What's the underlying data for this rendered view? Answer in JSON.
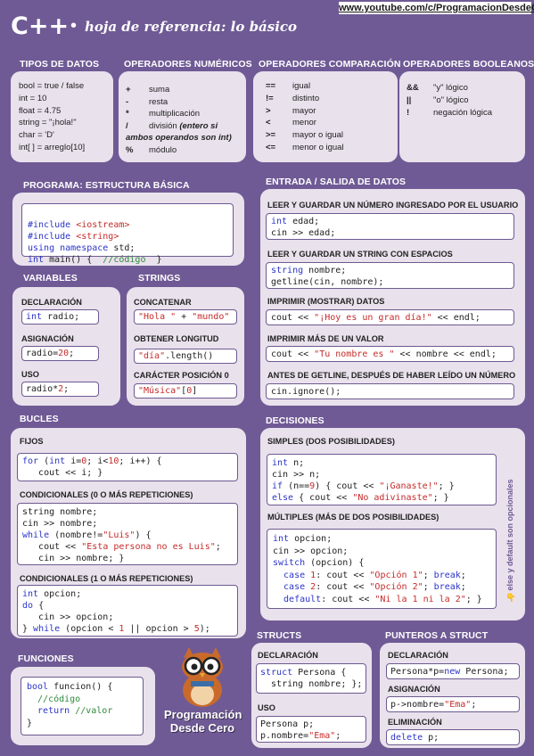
{
  "header": {
    "url": "www.youtube.com/c/ProgramacionDesdeCero",
    "brand": "C++",
    "dot": "•",
    "subtitle": "hoja de referencia: lo básico"
  },
  "tipos": {
    "title": "TIPOS DE DATOS",
    "lines": [
      "bool = true / false",
      "int = 10",
      "float = 4.75",
      "string = \"¡hola!\"",
      "char = 'D'",
      "int[ ] = arreglo[10]"
    ]
  },
  "numericos": {
    "title": "OPERADORES NUMÉRICOS",
    "items": [
      {
        "sym": "+",
        "desc": "suma"
      },
      {
        "sym": "-",
        "desc": "resta"
      },
      {
        "sym": "*",
        "desc": "multiplicación"
      },
      {
        "sym": "/",
        "desc": "división",
        "note": "(entero si",
        "note2": "ambos operandos son int)"
      },
      {
        "sym": "%",
        "desc": "módulo"
      }
    ]
  },
  "comparacion": {
    "title": "OPERADORES COMPARACIÓN",
    "items": [
      {
        "sym": "==",
        "desc": "igual"
      },
      {
        "sym": "!=",
        "desc": "distinto"
      },
      {
        "sym": ">",
        "desc": "mayor"
      },
      {
        "sym": "<",
        "desc": "menor"
      },
      {
        "sym": ">=",
        "desc": "mayor o igual"
      },
      {
        "sym": "<=",
        "desc": "menor o igual"
      }
    ]
  },
  "booleanos": {
    "title": "OPERADORES BOOLEANOS",
    "items": [
      {
        "sym": "&&",
        "desc": "\"y\" lógico"
      },
      {
        "sym": "||",
        "desc": "\"o\" lógico"
      },
      {
        "sym": "!",
        "desc": "negación lógica"
      }
    ]
  },
  "programa": {
    "title": "PROGRAMA: ESTRUCTURA BÁSICA",
    "l1a": "#include ",
    "l1b": "<iostream>",
    "l2a": "#include ",
    "l2b": "<string>",
    "l3a": "using namespace",
    "l3b": " std;",
    "l4a": "int",
    "l4b": " main() {  ",
    "l4c": "//código",
    "l4d": "  }"
  },
  "variables": {
    "title": "VARIABLES",
    "decl_label": "DECLARACIÓN",
    "decl_kw": "int",
    "decl_code": " radio;",
    "asig_label": "ASIGNACIÓN",
    "asig_code": "radio=",
    "asig_num": "20",
    "asig_end": ";",
    "uso_label": "USO",
    "uso_code": "radio*",
    "uso_num": "2",
    "uso_end": ";"
  },
  "strings": {
    "title": "STRINGS",
    "concat_label": "CONCATENAR",
    "concat_s1": "\"Hola \"",
    "concat_op": " + ",
    "concat_s2": "\"mundo\"",
    "len_label": "OBTENER LONGITUD",
    "len_s": "\"día\"",
    "len_code": ".length()",
    "char_label": "CARÁCTER POSICIÓN 0",
    "char_s": "\"Música\"",
    "char_code": "[",
    "char_num": "0",
    "char_end": "]"
  },
  "io": {
    "title": "ENTRADA / SALIDA DE DATOS",
    "l1": "LEER Y GUARDAR  UN NÚMERO INGRESADO POR EL USUARIO",
    "c1a": "int",
    "c1b": " edad;",
    "c1c": "cin >> edad;",
    "l2": "LEER Y GUARDAR UN STRING CON ESPACIOS",
    "c2a": "string",
    "c2b": " nombre;",
    "c2c": "getline(cin, nombre);",
    "l3": "IMPRIMIR (MOSTRAR) DATOS",
    "c3a": "cout << ",
    "c3b": "\"¡Hoy es un gran día!\"",
    "c3c": " << endl;",
    "l4": "IMPRIMIR MÁS DE UN VALOR",
    "c4a": "cout << ",
    "c4b": "\"Tu nombre es \"",
    "c4c": " << nombre << endl;",
    "l5": "ANTES DE GETLINE, DESPUÉS DE HABER LEÍDO UN NÚMERO",
    "c5": "cin.ignore();"
  },
  "bucles": {
    "title": "BUCLES",
    "fijos_label": "FIJOS",
    "f1a": "for",
    "f1b": " (",
    "f1c": "int",
    "f1d": " i=",
    "f1e": "0",
    "f1f": "; i<",
    "f1g": "10",
    "f1h": "; i++) {",
    "f2": "   cout << i; }",
    "w_label": "CONDICIONALES (0 O MÁS REPETICIONES)",
    "w1": "string nombre;",
    "w2": "cin >> nombre;",
    "w3a": "while",
    "w3b": " (nombre!=",
    "w3c": "\"Luis\"",
    "w3d": ") {",
    "w4a": "   cout << ",
    "w4b": "\"Esta persona no es Luis\"",
    "w4c": ";",
    "w5": "   cin >> nombre; }",
    "d_label": "CONDICIONALES (1 O MÁS REPETICIONES)",
    "d1a": "int",
    "d1b": " opcion;",
    "d2": "do",
    "d2b": " {",
    "d3": "   cin >> opcion;",
    "d4a": "} ",
    "d4b": "while",
    "d4c": " (opcion < ",
    "d4d": "1",
    "d4e": " || opcion > ",
    "d4f": "5",
    "d4g": ");"
  },
  "decisiones": {
    "title": "DECISIONES",
    "simple_label": "SIMPLES (DOS POSIBILIDADES)",
    "s1a": "int",
    "s1b": " n;",
    "s2": "cin >> n;",
    "s3a": "if",
    "s3b": " (n==",
    "s3c": "9",
    "s3d": ") { cout << ",
    "s3e": "\"¡Ganaste!\"",
    "s3f": "; }",
    "s4a": "else",
    "s4b": " { cout << ",
    "s4c": "\"No adivinaste\"",
    "s4d": "; }",
    "multi_label": "MÚLTIPLES (MÁS DE DOS POSIBILIDADES)",
    "m1a": "int",
    "m1b": " opcion;",
    "m2": "cin >> opcion;",
    "m3a": "switch",
    "m3b": " (opcion) {",
    "m4a": "  case ",
    "m4b": "1",
    "m4c": ": cout << ",
    "m4d": "\"Opción 1\"",
    "m4e": "; ",
    "m4f": "break",
    "m4g": ";",
    "m5a": "  case ",
    "m5b": "2",
    "m5c": ": cout << ",
    "m5d": "\"Opción 2\"",
    "m5e": "; ",
    "m5f": "break",
    "m5g": ";",
    "m6a": "  default",
    "m6b": ": cout << ",
    "m6c": "\"Ni la 1 ni la 2\"",
    "m6d": "; }",
    "side_note": "👆 else y default son opcionales"
  },
  "funciones": {
    "title": "FUNCIONES",
    "f1a": "bool",
    "f1b": " funcion() {",
    "f2": "  //código",
    "f3a": "  return",
    "f3b": " //valor",
    "f4": "}"
  },
  "logo": {
    "line1": "Programación",
    "line2": "Desde Cero"
  },
  "structs": {
    "title": "STRUCTS",
    "decl_label": "DECLARACIÓN",
    "d1a": "struct",
    "d1b": " Persona {",
    "d2a": "  string",
    "d2b": " nombre; };",
    "uso_label": "USO",
    "u1": "Persona p;",
    "u2a": "p.nombre=",
    "u2b": "\"Ema\"",
    "u2c": ";"
  },
  "punteros": {
    "title": "PUNTEROS  A STRUCT",
    "decl_label": "DECLARACIÓN",
    "d1a": "Persona*p=",
    "d1b": "new",
    "d1c": " Persona;",
    "asig_label": "ASIGNACIÓN",
    "a1a": "p->nombre=",
    "a1b": "\"Ema\"",
    "a1c": ";",
    "elim_label": "ELIMINACIÓN",
    "e1a": "delete",
    "e1b": " p;"
  }
}
